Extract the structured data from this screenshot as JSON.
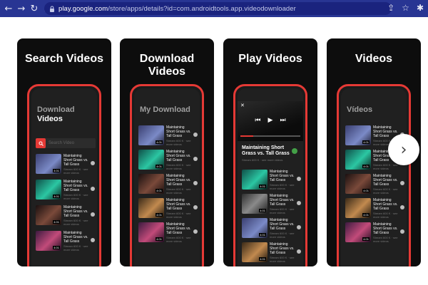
{
  "browser": {
    "url_host": "play.google.com",
    "url_path": "/store/apps/details?id=com.androidtools.app.videodownloader"
  },
  "screenshots": [
    {
      "title": "Search Videos",
      "screen_heading_1": "Download",
      "screen_heading_2": "Videos",
      "search_placeholder": "Search Video",
      "videos": [
        {
          "title": "Maintaining Short Grass vs. Tall Grass",
          "sub": "Stream 600 K · see more videos",
          "dur": "4:01"
        },
        {
          "title": "Maintaining Short Grass vs. Tall Grass",
          "sub": "Stream 600 K · see more videos",
          "dur": "4:01"
        },
        {
          "title": "Maintaining Short Grass vs. Tall Grass",
          "sub": "Stream 600 K · see more videos",
          "dur": "4:01"
        },
        {
          "title": "Maintaining Short Grass vs. Tall Grass",
          "sub": "Stream 600 K · see more videos",
          "dur": "4:01"
        }
      ]
    },
    {
      "title": "Download Videos",
      "screen_heading": "My Download",
      "videos": [
        {
          "title": "Maintaining Short Grass vs. Tall Grass",
          "sub": "Stream 600 K · see more videos",
          "dur": "4:01"
        },
        {
          "title": "Maintaining Short Grass vs. Tall Grass",
          "sub": "Stream 600 K · see more videos",
          "dur": "4:01"
        },
        {
          "title": "Maintaining Short Grass vs. Tall Grass",
          "sub": "Stream 600 K · see more videos",
          "dur": "4:01"
        },
        {
          "title": "Maintaining Short Grass vs. Tall Grass",
          "sub": "Stream 600 K · see more videos",
          "dur": "4:01"
        },
        {
          "title": "Maintaining Short Grass vs. Tall Grass",
          "sub": "Stream 600 K · see more videos",
          "dur": "4:01"
        }
      ]
    },
    {
      "title": "Play Videos",
      "now_playing_title": "Maintaining Short Grass vs. Tall Grass",
      "now_playing_sub": "Stream 600 K · see more videos",
      "videos": [
        {
          "title": "Maintaining Short Grass vs. Tall Grass",
          "sub": "Stream 600 K · see more videos",
          "dur": "4:01"
        },
        {
          "title": "Maintaining Short Grass vs. Tall Grass",
          "sub": "Stream 600 K · see more videos",
          "dur": "4:01"
        },
        {
          "title": "Maintaining Short Grass vs. Tall Grass",
          "sub": "Stream 600 K · see more videos",
          "dur": "4:01"
        },
        {
          "title": "Maintaining Short Grass vs. Tall Grass",
          "sub": "Stream 600 K · see more videos",
          "dur": "4:01"
        }
      ]
    },
    {
      "title": "Videos",
      "screen_heading": "Vídeos",
      "videos": [
        {
          "title": "Maintaining Short Grass vs. Tall Grass",
          "sub": "Stream 600 K · see more videos",
          "dur": "4:01"
        },
        {
          "title": "Maintaining Short Grass vs. Tall Grass",
          "sub": "Stream 600 K · see more videos",
          "dur": "4:01"
        },
        {
          "title": "Maintaining Short Grass vs. Tall Grass",
          "sub": "Stream 600 K · see more videos",
          "dur": "4:01"
        },
        {
          "title": "Maintaining Short Grass vs. Tall Grass",
          "sub": "Stream 600 K · see more videos",
          "dur": "4:01"
        },
        {
          "title": "Maintaining Short Grass vs. Tall Grass",
          "sub": "Stream 600 K · see more videos",
          "dur": "4:01"
        }
      ]
    }
  ],
  "colors": {
    "browser_bar": "#283593",
    "accent_red": "#e53935",
    "card_bg": "#0d0d0d"
  }
}
